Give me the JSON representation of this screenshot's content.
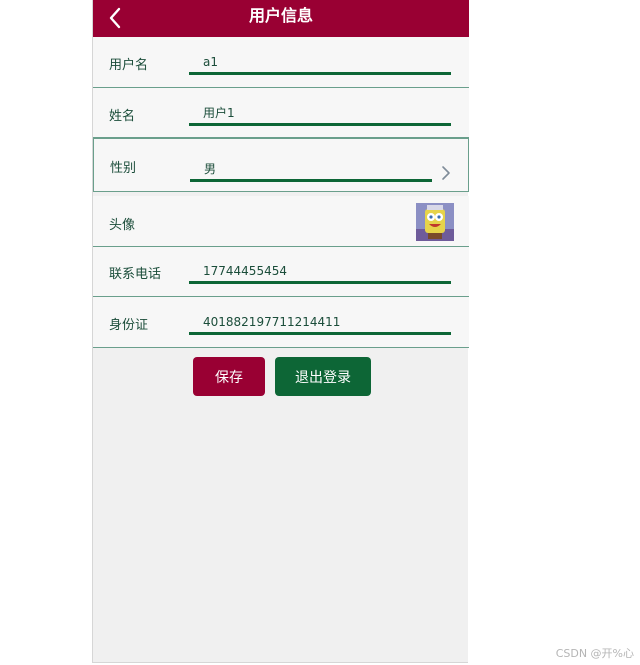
{
  "header": {
    "title": "用户信息",
    "back_icon": "chevron-left-icon"
  },
  "form": {
    "username": {
      "label": "用户名",
      "value": "a1"
    },
    "name": {
      "label": "姓名",
      "value": "用户1"
    },
    "gender": {
      "label": "性别",
      "value": "男",
      "icon": "chevron-right-icon"
    },
    "avatar": {
      "label": "头像"
    },
    "phone": {
      "label": "联系电话",
      "value": "17744455454"
    },
    "id_card": {
      "label": "身份证",
      "value": "401882197711214411"
    }
  },
  "actions": {
    "save_label": "保存",
    "logout_label": "退出登录"
  },
  "watermark": "CSDN @开%心",
  "colors": {
    "primary": "#990033",
    "secondary": "#0d6636",
    "background": "#f0f0f0"
  }
}
